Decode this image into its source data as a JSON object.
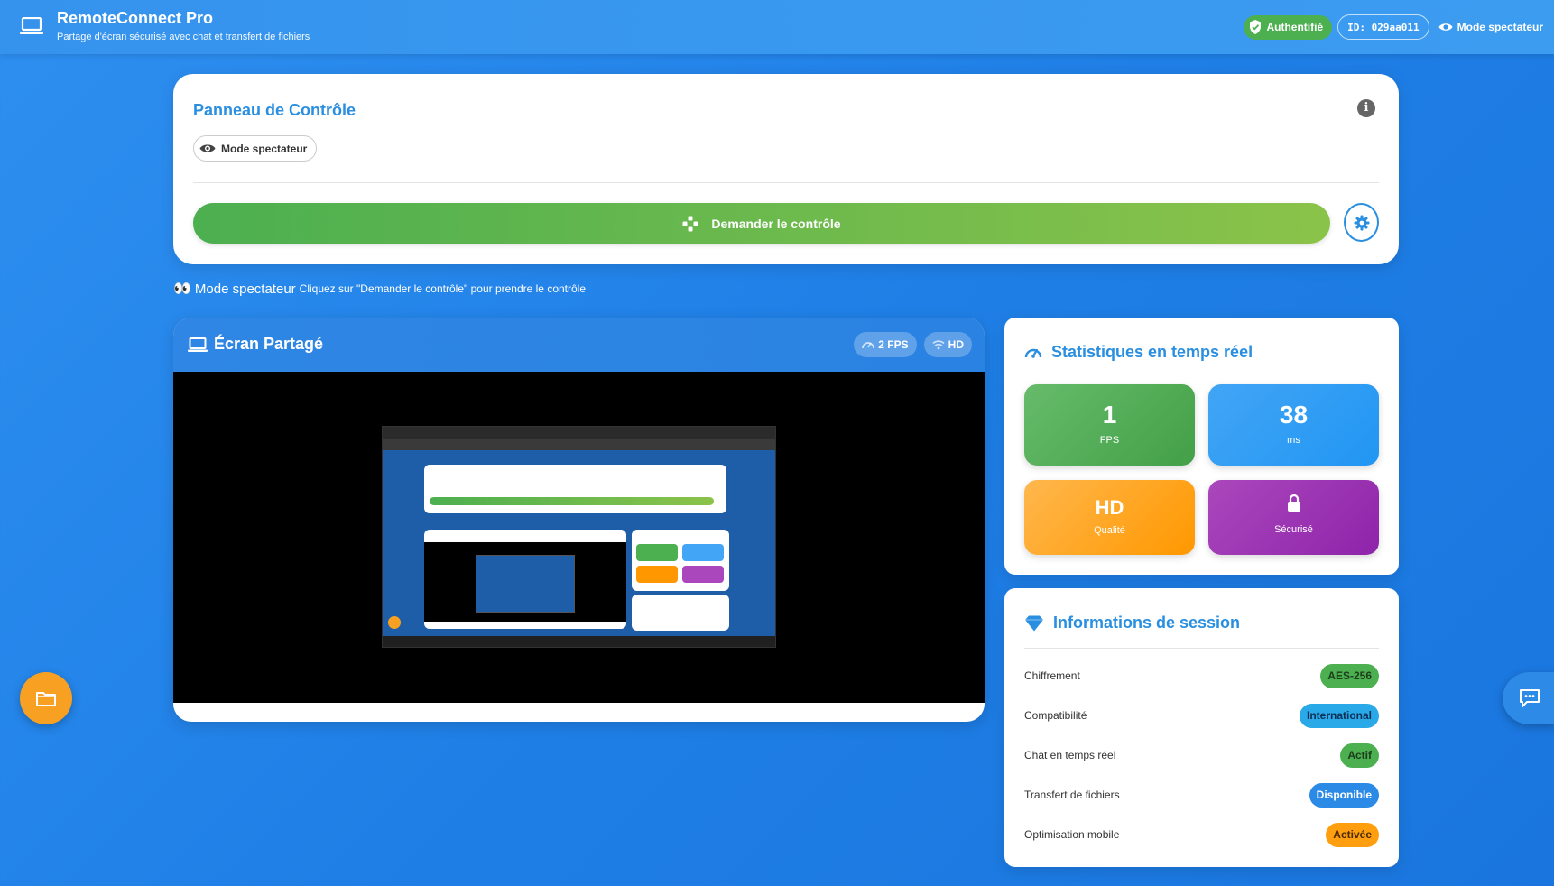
{
  "header": {
    "title": "RemoteConnect Pro",
    "subtitle": "Partage d'écran sécurisé avec chat et transfert de fichiers",
    "auth_badge": "Authentifié",
    "id_badge": "ID: 029aa011",
    "spectator_label": "Mode spectateur"
  },
  "control_panel": {
    "title": "Panneau de Contrôle",
    "mode_pill": "Mode spectateur",
    "request_button": "Demander le contrôle"
  },
  "spectator_note": {
    "emoji": "👀",
    "mode": "Mode spectateur",
    "hint": "Cliquez sur \"Demander le contrôle\" pour prendre le contrôle"
  },
  "screen": {
    "title": "Écran Partagé",
    "fps_chip": "2 FPS",
    "quality_chip": "HD"
  },
  "stats": {
    "title": "Statistiques en temps réel",
    "fps_value": "1",
    "fps_label": "FPS",
    "latency_value": "38",
    "latency_label": "ms",
    "quality_value": "HD",
    "quality_label": "Qualité",
    "security_label": "Sécurisé"
  },
  "session": {
    "title": "Informations de session",
    "rows": [
      {
        "label": "Chiffrement",
        "value": "AES-256",
        "bg": "#4caf50",
        "fg": "#1b3d1c"
      },
      {
        "label": "Compatibilité",
        "value": "International",
        "bg": "#29a9e8",
        "fg": "#0d2f55"
      },
      {
        "label": "Chat en temps réel",
        "value": "Actif",
        "bg": "#4caf50",
        "fg": "#1b3d1c"
      },
      {
        "label": "Transfert de fichiers",
        "value": "Disponible",
        "bg": "#2a8ae6",
        "fg": "#ffffff"
      },
      {
        "label": "Optimisation mobile",
        "value": "Activée",
        "bg": "#ff9f0f",
        "fg": "#4a2a00"
      }
    ]
  },
  "colors": {
    "accent": "#2a8fe0",
    "success": "#4caf50",
    "warning": "#ff9800",
    "purple": "#8e24aa"
  },
  "icons": {
    "app": "laptop-icon",
    "auth": "shield-icon",
    "eye": "eye-icon",
    "info": "info-icon",
    "request": "gamepad-icon",
    "settings": "gear-icon",
    "stats": "speedometer-icon",
    "session": "diamond-icon",
    "security": "lock-icon",
    "wifi": "wifi-icon",
    "folder": "folder-icon",
    "chat": "chat-icon"
  }
}
